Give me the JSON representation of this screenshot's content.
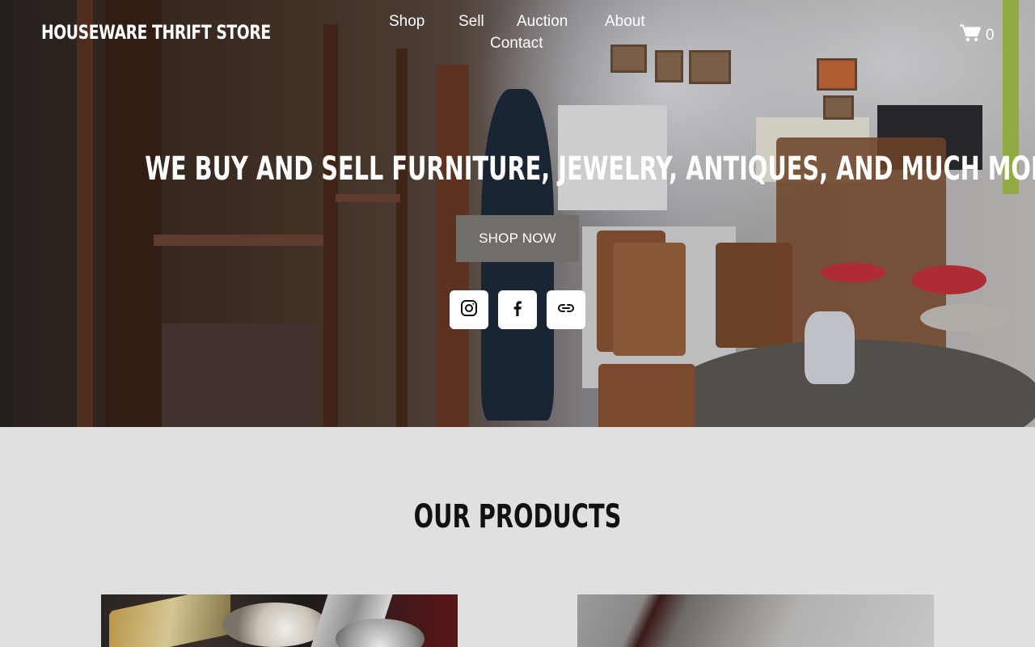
{
  "header": {
    "brand": "HOUSEWARE THRIFT STORE",
    "nav": [
      {
        "label": "Shop"
      },
      {
        "label": "Sell"
      },
      {
        "label": "Auction"
      },
      {
        "label": "About"
      },
      {
        "label": "Contact"
      }
    ],
    "cart": {
      "icon": "cart-icon",
      "count": "0"
    }
  },
  "hero": {
    "headline": "WE BUY AND SELL FURNITURE, JEWELRY, ANTIQUES, AND MUCH MORE.",
    "cta_label": "SHOP NOW",
    "social": [
      {
        "icon": "instagram-icon"
      },
      {
        "icon": "facebook-icon"
      },
      {
        "icon": "link-icon"
      }
    ]
  },
  "products": {
    "title": "OUR PRODUCTS"
  },
  "colors": {
    "button": "#716e6a",
    "page_background": "#dfe0e1",
    "text_light": "#ffffff",
    "text_dark": "#111111"
  }
}
